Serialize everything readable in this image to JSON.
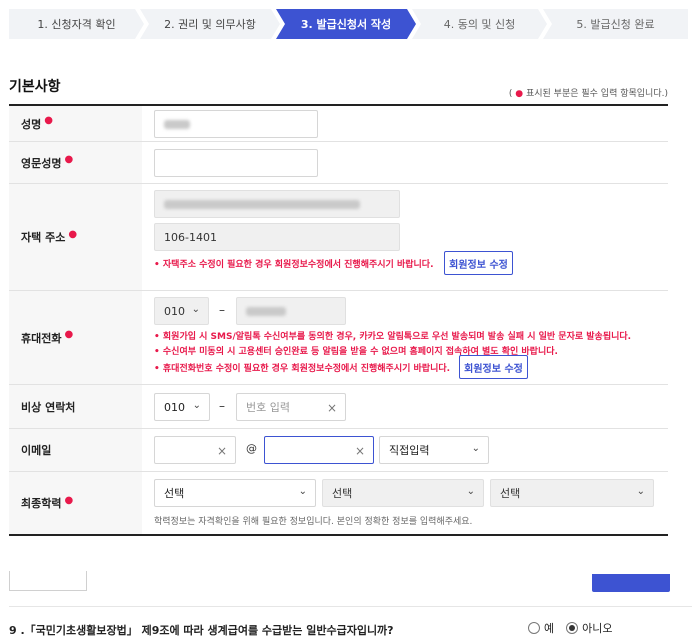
{
  "steps": [
    {
      "label": "1. 신청자격 확인"
    },
    {
      "label": "2. 권리 및 의무사항"
    },
    {
      "label": "3. 발급신청서 작성"
    },
    {
      "label": "4. 동의 및 신청"
    },
    {
      "label": "5. 발급신청 완료"
    }
  ],
  "section": {
    "title": "기본사항",
    "required_note_prefix": "( ",
    "required_note_dot": "●",
    "required_note_text": " 표시된 부분은 필수 입력 항목입니다.)"
  },
  "fields": {
    "name": {
      "label": "성명"
    },
    "english_name": {
      "label": "영문성명",
      "value": ""
    },
    "address": {
      "label": "자택 주소",
      "detail": "106-1401",
      "note": "• 자택주소 수정이 필요한 경우 회원정보수정에서 진행해주시기 바랍니다.",
      "button": "회원정보 수정"
    },
    "mobile": {
      "label": "휴대전화",
      "prefix": "010",
      "note1": "• 회원가입 시 SMS/알림톡 수신여부를 동의한 경우, 카카오 알림톡으로 우선 발송되며 발송 실패 시 일반 문자로 발송됩니다.",
      "note2": "• 수신여부 미동의 시 고용센터 승인완료 등 알림을 받을 수 없으며 홈페이지 접속하여 별도 확인 바랍니다.",
      "note3": "• 휴대전화번호 수정이 필요한 경우 회원정보수정에서 진행해주시기 바랍니다.",
      "button": "회원정보 수정"
    },
    "emergency": {
      "label": "비상 연락처",
      "prefix": "010",
      "placeholder": "번호 입력"
    },
    "email": {
      "label": "이메일",
      "at": "@",
      "domain_select": "직접입력"
    },
    "education": {
      "label": "최종학력",
      "select1": "선택",
      "select2": "선택",
      "select3": "선택",
      "note": "학력정보는 자격확인을 위해 필요한 정보입니다. 본인의 정확한 정보를 입력해주세요."
    }
  },
  "question9": {
    "text": "9 .「국민기초생활보장법」 제9조에 따라 생계급여를 수급받는 일반수급자입니까?",
    "yes": "예",
    "no": "아니오",
    "selected": "아니오"
  },
  "colors": {
    "accent": "#3d53d2",
    "required": "#e8194b"
  }
}
